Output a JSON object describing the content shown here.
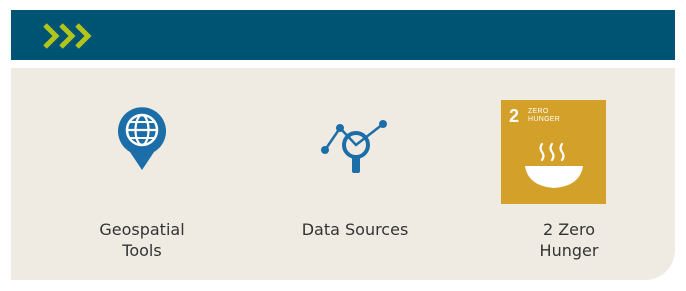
{
  "header": {
    "chevron_icon": "triple-chevron-right-icon",
    "bar_color": "#005473",
    "chevron_color": "#b3c51a"
  },
  "panel": {
    "background": "#efebe2",
    "icon_color": "#1b6ea8"
  },
  "tiles": [
    {
      "icon": "globe-pin-icon",
      "label": "Geospatial\nTools"
    },
    {
      "icon": "data-search-icon",
      "label": "Data Sources"
    },
    {
      "icon": "sdg-2-zero-hunger-icon",
      "label": "2 Zero\nHunger",
      "badge": {
        "number": "2",
        "title": "ZERO\nHUNGER",
        "color": "#d3a029"
      }
    }
  ]
}
